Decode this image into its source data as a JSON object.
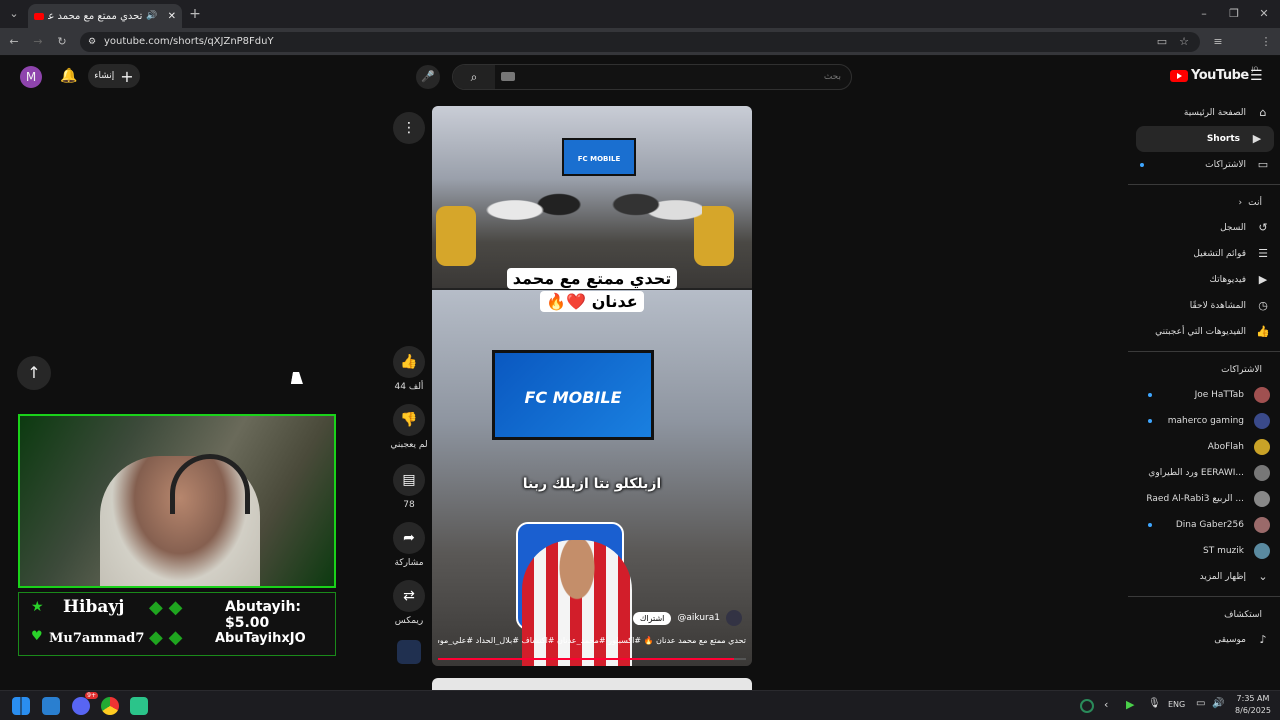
{
  "browser": {
    "tab_title": "تحدي ممتع مع محمد عدنان",
    "url": "youtube.com/shorts/qXJZnP8FduY",
    "profile_initial": "M"
  },
  "header": {
    "logo_text": "YouTube",
    "logo_country": "JO",
    "search_placeholder": "بحث",
    "create_label": "إنشاء",
    "avatar_initial": "M"
  },
  "sidebar": {
    "main": [
      {
        "label": "الصفحة الرئيسية",
        "icon": "home-icon",
        "glyph": "⌂"
      },
      {
        "label": "Shorts",
        "icon": "shorts-icon",
        "glyph": "▶",
        "active": true
      },
      {
        "label": "الاشتراكات",
        "icon": "subscriptions-icon",
        "glyph": "▭"
      }
    ],
    "you_heading": "أنت",
    "you": [
      {
        "label": "السجل",
        "icon": "history-icon",
        "glyph": "↺"
      },
      {
        "label": "قوائم التشغيل",
        "icon": "playlists-icon",
        "glyph": "☰"
      },
      {
        "label": "فيديوهاتك",
        "icon": "your-videos-icon",
        "glyph": "▶"
      },
      {
        "label": "المشاهدة لاحقًا",
        "icon": "watch-later-icon",
        "glyph": "◷"
      },
      {
        "label": "الفيديوهات التي أعجبتني",
        "icon": "liked-videos-icon",
        "glyph": "👍"
      }
    ],
    "subs_heading": "الاشتراكات",
    "subscriptions": [
      {
        "label": "Joe HaTTab",
        "color": "#a05050"
      },
      {
        "label": "maherco gaming",
        "color": "#3a4a8a"
      },
      {
        "label": "AboFlah",
        "color": "#c9a227"
      },
      {
        "label": "ورد الطيراوي EERAWI...",
        "color": "#777777"
      },
      {
        "label": "Raed Al-Rabi3 الربيع ...",
        "color": "#888888"
      },
      {
        "label": "Dina Gaber256",
        "color": "#9a6a6a"
      },
      {
        "label": "ST muzik",
        "color": "#5a8aa0"
      }
    ],
    "show_more": "إظهار المزيد",
    "explore_heading": "استكشاف",
    "explore": [
      {
        "label": "موسيقى",
        "icon": "music-icon",
        "glyph": "♪"
      }
    ]
  },
  "short": {
    "title_overlay_line1": "تحدي ممتع مع محمد",
    "title_overlay_line2": "عدنان ❤️🔥",
    "screen_text": "FC MOBILE",
    "caption_overlay": "ازبلكلو نتا ازبلك ربنا",
    "channel": "@aikura1",
    "subscribe": "اشتراك",
    "description": "تحدي ممتع مع محمد عدنان 🔥 #اكسبلور #محمد_عدنان #اكتشاف #بلال_الحداد #علي_موسى"
  },
  "actions": {
    "like_count": "44 ألف",
    "dislike_label": "لم يعجبني",
    "comments_count": "78",
    "share_label": "مشاركة",
    "remix_label": "ريمكس"
  },
  "overlay": {
    "viewer1": "Hibayj",
    "donation": "Abutayih: $5.00",
    "viewer2": "Mu7ammad7",
    "handle": "AbuTayihxJO"
  },
  "taskbar": {
    "lang": "ENG",
    "time": "7:35 AM",
    "date": "8/6/2025",
    "discord_badge": "9+"
  }
}
